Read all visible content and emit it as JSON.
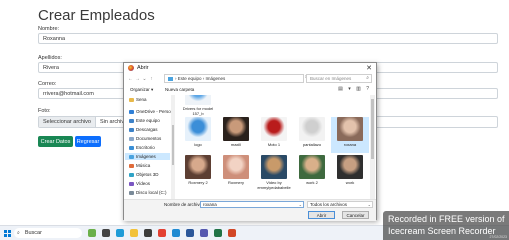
{
  "page": {
    "title": "Crear Empleados",
    "fields": [
      {
        "label": "Nombre:",
        "value": "Roxanna"
      },
      {
        "label": "Apellidos:",
        "value": "Rivera"
      },
      {
        "label": "Correo:",
        "value": "rrivera@hotmail.com"
      }
    ],
    "photo_label": "Foto:",
    "file_button": "Seleccionar archivo",
    "file_status": "Sin archivos se",
    "create_button": "Crear Datos",
    "back_button": "Regresar",
    "colors": {
      "create": "#198754",
      "back": "#0d6efd"
    }
  },
  "dialog": {
    "title": "Abrir",
    "breadcrumb": [
      "Este equipo",
      "Imágenes"
    ],
    "search_placeholder": "Buscar en Imágenes",
    "organize": "Organizar ▾",
    "new_folder": "Nueva carpeta",
    "nav": [
      {
        "label": "Sena",
        "icon": "folder-icon",
        "color": "#e8b94a"
      },
      {
        "label": "OneDrive - Person",
        "icon": "cloud-icon",
        "color": "#2f7fd6"
      },
      {
        "label": "Este equipo",
        "icon": "computer-icon",
        "color": "#3d82c8"
      },
      {
        "label": "Descargas",
        "icon": "download-icon",
        "color": "#3d82c8"
      },
      {
        "label": "Documentos",
        "icon": "document-icon",
        "color": "#8aa7c9"
      },
      {
        "label": "Escritorio",
        "icon": "desktop-icon",
        "color": "#3a8fd6"
      },
      {
        "label": "Imágenes",
        "icon": "pictures-icon",
        "color": "#4aa3df"
      },
      {
        "label": "Música",
        "icon": "music-icon",
        "color": "#e06b3a"
      },
      {
        "label": "Objetos 3D",
        "icon": "cube-icon",
        "color": "#2fa3c6"
      },
      {
        "label": "Vídeos",
        "icon": "video-icon",
        "color": "#7a56c2"
      },
      {
        "label": "Disco local (C:)",
        "icon": "drive-icon",
        "color": "#7a8a99"
      }
    ],
    "files": [
      {
        "name": "Drivers for model\n157_b",
        "color": "#eef3f8",
        "accent": "#5aa5e6"
      },
      {
        "name": "",
        "color": "#ffffff",
        "accent": "#ffffff"
      },
      {
        "name": "",
        "color": "#ffffff",
        "accent": "#ffffff"
      },
      {
        "name": "",
        "color": "#ffffff",
        "accent": "#ffffff"
      },
      {
        "name": "",
        "color": "#ffffff",
        "accent": "#ffffff"
      },
      {
        "name": "logo",
        "color": "#e6f1fb",
        "accent": "#3b8ed8"
      },
      {
        "name": "maxill",
        "color": "#2a211c",
        "accent": "#c99a7a"
      },
      {
        "name": "Moto 1",
        "color": "#f4f4f4",
        "accent": "#b91c1c"
      },
      {
        "name": "pantallazo",
        "color": "#f2f2f2",
        "accent": "#cfcfcf"
      },
      {
        "name": "roxana",
        "color": "#8a6a5a",
        "accent": "#e3c2ac"
      },
      {
        "name": "Roxmery 2",
        "color": "#5d3f33",
        "accent": "#d7a98c"
      },
      {
        "name": "Roxmery",
        "color": "#ce8f7a",
        "accent": "#f2d3c4"
      },
      {
        "name": "Video by\nemmylyedababelle",
        "color": "#2a4a66",
        "accent": "#c89a6a"
      },
      {
        "name": "work 2",
        "color": "#3f6a3f",
        "accent": "#d9b08a"
      },
      {
        "name": "work",
        "color": "#2f2f2f",
        "accent": "#c79f82"
      }
    ],
    "filename_label": "Nombre de archivo:",
    "filename_value": "roxana",
    "filetype_value": "Todos los archivos",
    "open_button": "Abrir",
    "cancel_button": "Cancelar"
  },
  "overlay": {
    "line1": "Recorded in FREE version of",
    "line2": "Icecream Screen Recorder",
    "time": "27/02/2023"
  },
  "taskbar": {
    "search_label": "Buscar",
    "icons": [
      {
        "name": "plant-icon",
        "color": "#6bb04a"
      },
      {
        "name": "task-view-icon",
        "color": "#444444"
      },
      {
        "name": "edge-icon",
        "color": "#1e9bd7"
      },
      {
        "name": "file-explorer-icon",
        "color": "#f2c23b"
      },
      {
        "name": "store-icon",
        "color": "#3d3d3d"
      },
      {
        "name": "chrome-icon",
        "color": "#e34133"
      },
      {
        "name": "vscode-icon",
        "color": "#1f8ad2"
      },
      {
        "name": "word-icon",
        "color": "#2b579a"
      },
      {
        "name": "teams-icon",
        "color": "#5558af"
      },
      {
        "name": "excel-icon",
        "color": "#217346"
      },
      {
        "name": "app-icon",
        "color": "#d24726"
      }
    ]
  }
}
